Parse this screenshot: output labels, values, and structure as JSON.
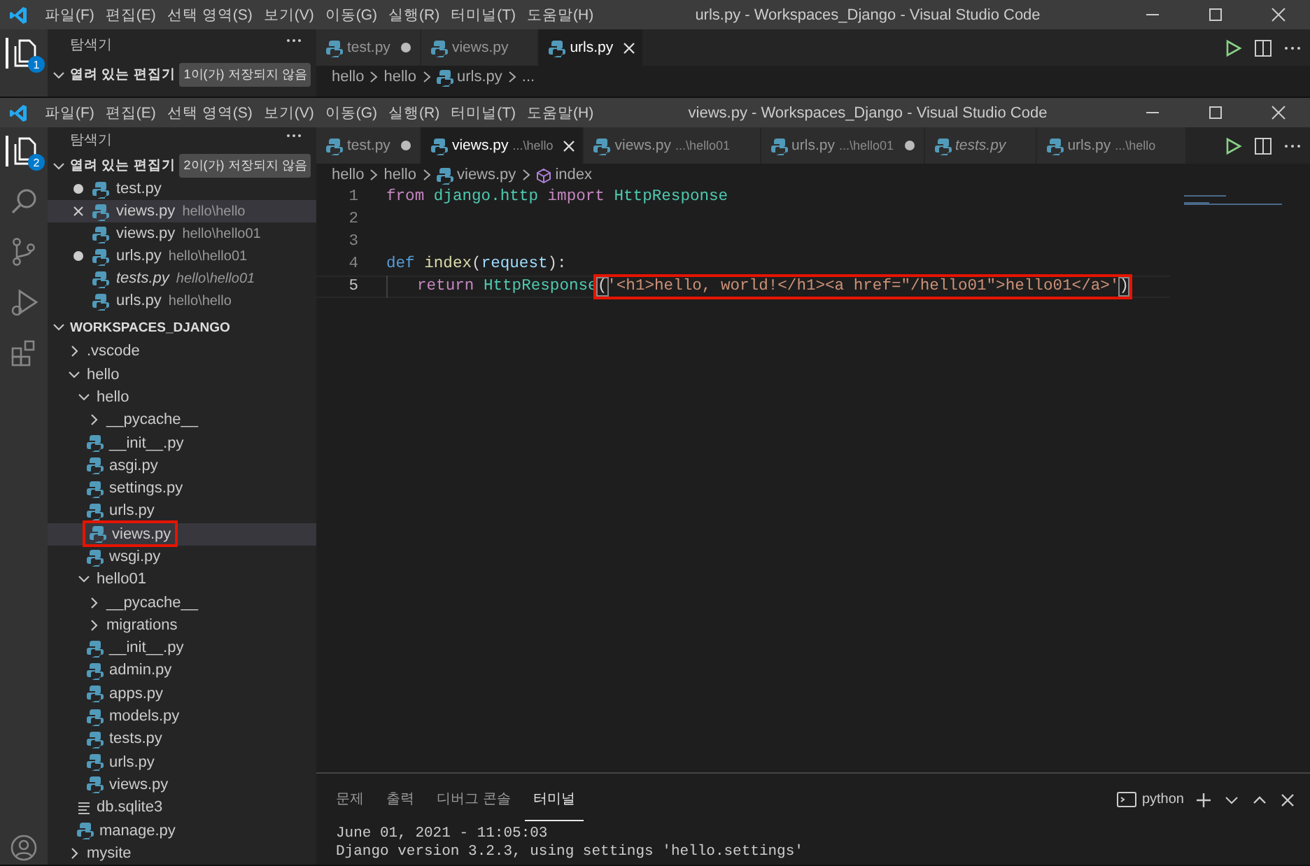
{
  "back_window": {
    "title": "urls.py - Workspaces_Django - Visual Studio Code",
    "menu": [
      "파일(F)",
      "편집(E)",
      "선택 영역(S)",
      "보기(V)",
      "이동(G)",
      "실행(R)",
      "터미널(T)",
      "도움말(H)"
    ],
    "activity_badge": "1",
    "explorer_title": "탐색기",
    "open_editors": {
      "label": "열려 있는 편집기",
      "badge": "1이(가) 저장되지 않음"
    },
    "tabs": [
      {
        "label": "test.py",
        "dirty": true,
        "selected": false,
        "preview": false
      },
      {
        "label": "views.py",
        "dirty": false,
        "selected": false,
        "preview": false
      },
      {
        "label": "urls.py",
        "dirty": false,
        "selected": true,
        "preview": false
      }
    ],
    "breadcrumb": [
      {
        "text": "hello",
        "kind": "folder"
      },
      {
        "text": "hello",
        "kind": "folder"
      },
      {
        "text": "urls.py",
        "kind": "file"
      },
      {
        "text": "...",
        "kind": "folder"
      }
    ]
  },
  "front_window": {
    "title": "views.py - Workspaces_Django - Visual Studio Code",
    "menu": [
      "파일(F)",
      "편집(E)",
      "선택 영역(S)",
      "보기(V)",
      "이동(G)",
      "실행(R)",
      "터미널(T)",
      "도움말(H)"
    ],
    "activity_badge": "2",
    "explorer_title": "탐색기",
    "open_editors": {
      "label": "열려 있는 편집기",
      "badge": "2이(가) 저장되지 않음",
      "items": [
        {
          "name": "test.py",
          "dirty": true,
          "selected": false,
          "preview": false
        },
        {
          "name": "views.py",
          "path": "hello\\hello",
          "dirty": false,
          "selected": true,
          "preview": false
        },
        {
          "name": "views.py",
          "path": "hello\\hello01",
          "dirty": false,
          "selected": false,
          "preview": false
        },
        {
          "name": "urls.py",
          "path": "hello\\hello01",
          "dirty": true,
          "selected": false,
          "preview": false
        },
        {
          "name": "tests.py",
          "path": "hello\\hello01",
          "dirty": false,
          "selected": false,
          "preview": true
        },
        {
          "name": "urls.py",
          "path": "hello\\hello",
          "dirty": false,
          "selected": false,
          "preview": false
        }
      ]
    },
    "workspace": {
      "label": "WORKSPACES_DJANGO",
      "tree": [
        {
          "name": ".vscode",
          "kind": "folder",
          "expanded": false,
          "selected": false,
          "marked": false
        },
        {
          "name": "hello",
          "kind": "folder",
          "expanded": true,
          "selected": false,
          "marked": false,
          "children": [
            {
              "name": "hello",
              "kind": "folder",
              "expanded": true,
              "selected": false,
              "marked": false,
              "children": [
                {
                  "name": "__pycache__",
                  "kind": "folder",
                  "expanded": false,
                  "selected": false,
                  "marked": false
                },
                {
                  "name": "__init__.py",
                  "kind": "python",
                  "selected": false,
                  "marked": false
                },
                {
                  "name": "asgi.py",
                  "kind": "python",
                  "selected": false,
                  "marked": false
                },
                {
                  "name": "settings.py",
                  "kind": "python",
                  "selected": false,
                  "marked": false
                },
                {
                  "name": "urls.py",
                  "kind": "python",
                  "selected": false,
                  "marked": false
                },
                {
                  "name": "views.py",
                  "kind": "python",
                  "selected": true,
                  "marked": true
                },
                {
                  "name": "wsgi.py",
                  "kind": "python",
                  "selected": false,
                  "marked": false
                }
              ]
            },
            {
              "name": "hello01",
              "kind": "folder",
              "expanded": true,
              "selected": false,
              "marked": false,
              "children": [
                {
                  "name": "__pycache__",
                  "kind": "folder",
                  "expanded": false,
                  "selected": false,
                  "marked": false
                },
                {
                  "name": "migrations",
                  "kind": "folder",
                  "expanded": false,
                  "selected": false,
                  "marked": false
                },
                {
                  "name": "__init__.py",
                  "kind": "python",
                  "selected": false,
                  "marked": false
                },
                {
                  "name": "admin.py",
                  "kind": "python",
                  "selected": false,
                  "marked": false
                },
                {
                  "name": "apps.py",
                  "kind": "python",
                  "selected": false,
                  "marked": false
                },
                {
                  "name": "models.py",
                  "kind": "python",
                  "selected": false,
                  "marked": false
                },
                {
                  "name": "tests.py",
                  "kind": "python",
                  "selected": false,
                  "marked": false
                },
                {
                  "name": "urls.py",
                  "kind": "python",
                  "selected": false,
                  "marked": false
                },
                {
                  "name": "views.py",
                  "kind": "python",
                  "selected": false,
                  "marked": false
                }
              ]
            },
            {
              "name": "db.sqlite3",
              "kind": "database",
              "selected": false,
              "marked": false
            },
            {
              "name": "manage.py",
              "kind": "python",
              "selected": false,
              "marked": false
            }
          ]
        },
        {
          "name": "mysite",
          "kind": "folder",
          "expanded": false,
          "selected": false,
          "marked": false
        }
      ]
    },
    "tabs": [
      {
        "label": "test.py",
        "dirty": true,
        "selected": false,
        "preview": false
      },
      {
        "label": "views.py",
        "description": "...\\hello",
        "dirty": false,
        "selected": true,
        "preview": false
      },
      {
        "label": "views.py",
        "description": "...\\hello01",
        "dirty": false,
        "selected": false,
        "preview": false
      },
      {
        "label": "urls.py",
        "description": "...\\hello01",
        "dirty": true,
        "selected": false,
        "preview": false
      },
      {
        "label": "tests.py",
        "dirty": false,
        "selected": false,
        "preview": true
      },
      {
        "label": "urls.py",
        "description": "...\\hello",
        "dirty": false,
        "selected": false,
        "preview": false
      }
    ],
    "breadcrumb": [
      {
        "text": "hello",
        "kind": "folder"
      },
      {
        "text": "hello",
        "kind": "folder"
      },
      {
        "text": "views.py",
        "kind": "file"
      },
      {
        "text": "index",
        "kind": "symbol"
      }
    ],
    "code": [
      {
        "number": "1",
        "active": false,
        "tokens": [
          {
            "text": "from ",
            "kind": "control"
          },
          {
            "text": "django.http ",
            "kind": "type"
          },
          {
            "text": "import ",
            "kind": "control"
          },
          {
            "text": "HttpResponse",
            "kind": "type"
          }
        ]
      },
      {
        "number": "2",
        "active": false
      },
      {
        "number": "3",
        "active": false
      },
      {
        "number": "4",
        "active": false,
        "tokens": [
          {
            "text": "def ",
            "kind": "keyword"
          },
          {
            "text": "index",
            "kind": "function"
          },
          {
            "text": "(",
            "kind": "plain"
          },
          {
            "text": "request",
            "kind": "param"
          },
          {
            "text": "):",
            "kind": "plain"
          }
        ]
      },
      {
        "number": "5",
        "active": true,
        "indented": true,
        "tokens": [
          {
            "text": "return ",
            "kind": "control"
          },
          {
            "text": "HttpResponse",
            "kind": "type"
          }
        ],
        "boxed_tokens": [
          {
            "text": "(",
            "kind": "bracket"
          },
          {
            "text": "'<h1>hello, world!</h1><a href=\"/hello01\">hello01</a>'",
            "kind": "string"
          },
          {
            "text": ")",
            "kind": "bracket"
          }
        ]
      }
    ],
    "panel": {
      "tabs": [
        {
          "label": "문제",
          "selected": false
        },
        {
          "label": "출력",
          "selected": false
        },
        {
          "label": "디버그 콘솔",
          "selected": false
        },
        {
          "label": "터미널",
          "selected": true
        }
      ],
      "shell": "python",
      "lines": [
        "June 01, 2021 - 11:05:03",
        "Django version 3.2.3, using settings 'hello.settings'"
      ]
    }
  }
}
